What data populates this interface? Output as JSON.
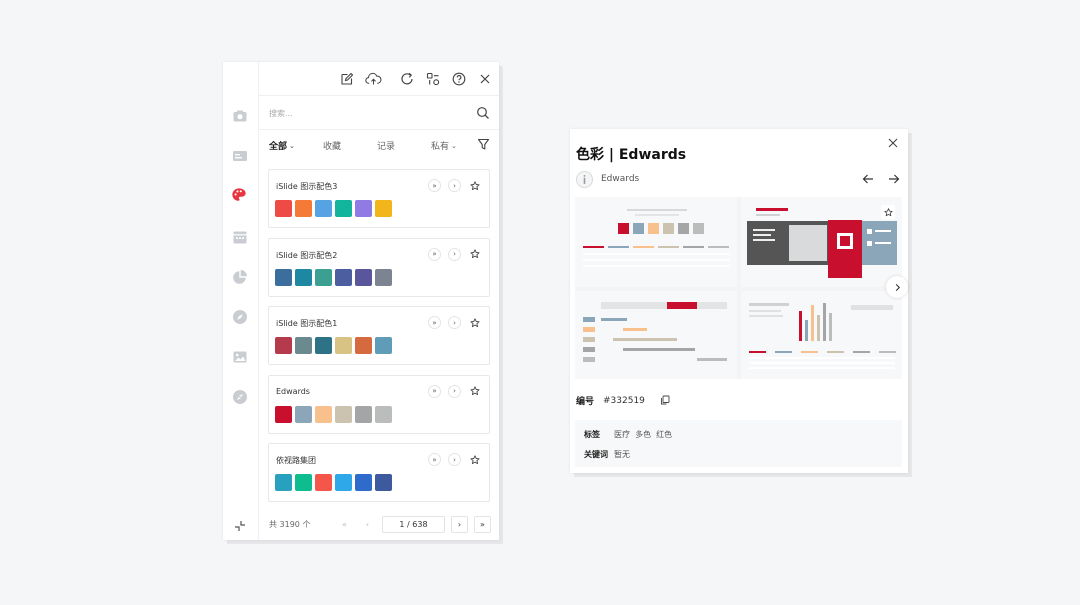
{
  "sidebar": {
    "icons": [
      "camera-icon",
      "card-icon",
      "palette-icon",
      "calendar-icon",
      "pie-chart-icon",
      "compass-icon",
      "image-icon",
      "explore-icon"
    ],
    "active_index": 2,
    "accent": "#e8343f"
  },
  "toolbar": {
    "icons": [
      "edit-icon",
      "cloud-upload-icon",
      "refresh-icon",
      "shapes-icon",
      "help-icon",
      "close-icon"
    ]
  },
  "search": {
    "placeholder": "搜索..."
  },
  "tabs": [
    {
      "label": "全部",
      "active": true,
      "dropdown": true
    },
    {
      "label": "收藏",
      "active": false,
      "dropdown": false
    },
    {
      "label": "记录",
      "active": false,
      "dropdown": false
    },
    {
      "label": "私有",
      "active": false,
      "dropdown": true
    }
  ],
  "cards": [
    {
      "title": "iSlide 图示配色3",
      "colors": [
        "#ee4b47",
        "#f57a38",
        "#55a3e3",
        "#12b59c",
        "#8f7be3",
        "#f2b51c"
      ]
    },
    {
      "title": "iSlide 图示配色2",
      "colors": [
        "#3c6e9d",
        "#1e87a1",
        "#3b9f92",
        "#4c5e9f",
        "#59569b",
        "#7c8391"
      ]
    },
    {
      "title": "iSlide 图示配色1",
      "colors": [
        "#b53a4c",
        "#6b8a8f",
        "#2d7287",
        "#d8c385",
        "#d66a3f",
        "#5e9cb8"
      ]
    },
    {
      "title": "Edwards",
      "colors": [
        "#c8102e",
        "#8ba6b9",
        "#f7c08d",
        "#cbc2b0",
        "#a4a5a7",
        "#bbbcbc"
      ]
    },
    {
      "title": "依视路集团",
      "colors": [
        "#2aa0bf",
        "#0dbd8d",
        "#f4564a",
        "#2ea8e9",
        "#2e6bcb",
        "#3d5a9e"
      ]
    }
  ],
  "pagination": {
    "total": "共 3190 个",
    "page": "1 / 638"
  },
  "detail": {
    "title": "色彩 | Edwards",
    "author": "Edwards",
    "code_label": "编号",
    "code": "#332519",
    "tags_label": "标签",
    "tags": "医疗  多色  红色",
    "keywords_label": "关键词",
    "keywords": "暂无",
    "accent": "#c8102e"
  }
}
